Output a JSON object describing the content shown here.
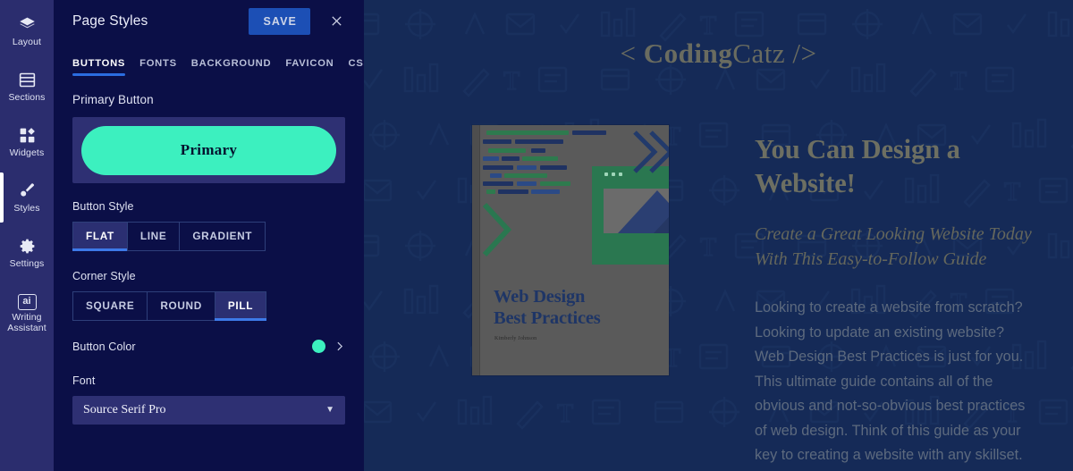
{
  "rail": {
    "items": [
      {
        "label": "Layout",
        "icon": "layers-icon",
        "name": "sidebar-item-layout",
        "active": false
      },
      {
        "label": "Sections",
        "icon": "sections-icon",
        "name": "sidebar-item-sections",
        "active": false
      },
      {
        "label": "Widgets",
        "icon": "widgets-grid-icon",
        "name": "sidebar-item-widgets",
        "active": false
      },
      {
        "label": "Styles",
        "icon": "paintbrush-icon",
        "name": "sidebar-item-styles",
        "active": true
      },
      {
        "label": "Settings",
        "icon": "gear-icon",
        "name": "sidebar-item-settings",
        "active": false
      },
      {
        "label": "Writing Assistant",
        "icon": "ai-badge-icon",
        "name": "sidebar-item-writing-assistant",
        "active": false
      }
    ]
  },
  "panel": {
    "title": "Page Styles",
    "save_label": "SAVE",
    "close_icon": "close-icon",
    "tabs": [
      {
        "label": "BUTTONS",
        "active": true
      },
      {
        "label": "FONTS",
        "active": false
      },
      {
        "label": "BACKGROUND",
        "active": false
      },
      {
        "label": "FAVICON",
        "active": false
      },
      {
        "label": "CSS",
        "active": false
      }
    ],
    "primary_button": {
      "section_label": "Primary Button",
      "preview_label": "Primary"
    },
    "button_style": {
      "label": "Button Style",
      "options": [
        "FLAT",
        "LINE",
        "GRADIENT"
      ],
      "selected": "FLAT"
    },
    "corner_style": {
      "label": "Corner Style",
      "options": [
        "SQUARE",
        "ROUND",
        "PILL"
      ],
      "selected": "PILL"
    },
    "button_color": {
      "label": "Button Color",
      "value": "#3cf0bf",
      "chevron_icon": "chevron-right-icon"
    },
    "font": {
      "label": "Font",
      "value": "Source Serif Pro",
      "caret_icon": "chevron-down-icon"
    }
  },
  "preview": {
    "logo": {
      "open": "< ",
      "bold": "Coding",
      "light": "Catz",
      "close": " />"
    },
    "book": {
      "title_line1": "Web Design",
      "title_line2": "Best Practices",
      "author": "Kimberly Johnson"
    },
    "heading": "You Can Design a Website!",
    "subheading": "Create a Great Looking Website Today With This Easy-to-Follow Guide",
    "body": "Looking to create a website from scratch? Looking to update an existing website? Web Design Best Practices is just for you. This ultimate guide contains all of the obvious and not-so-obvious best practices of web design. Think of this guide as your key to creating a website with any skillset."
  },
  "colors": {
    "rail_bg": "#2b2d6e",
    "panel_bg": "#0b0f47",
    "canvas_bg": "#152a57",
    "accent_blue": "#2b6de0",
    "save_blue": "#1c4fb5",
    "button_teal": "#3cf0bf",
    "book_green": "#2a7750",
    "book_paper": "#5a5a5a"
  }
}
